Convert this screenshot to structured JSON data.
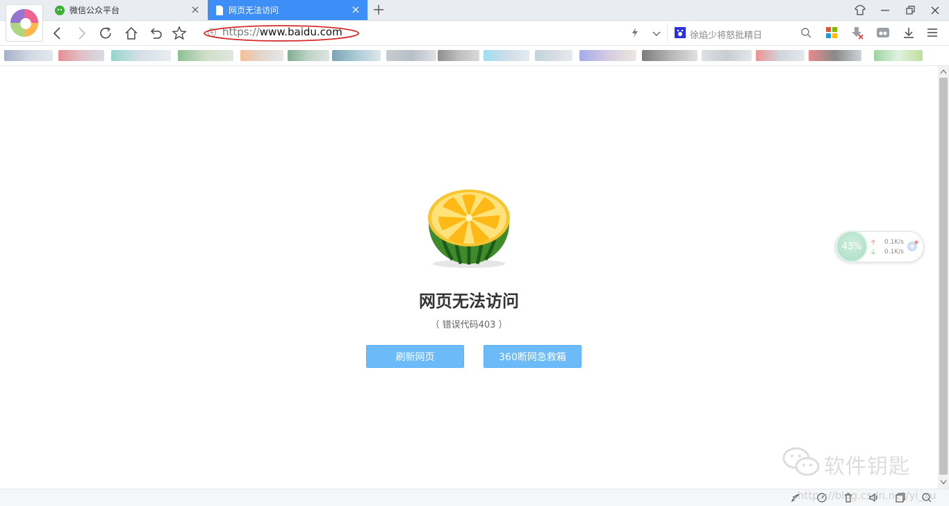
{
  "tabs": [
    {
      "label": "微信公众平台",
      "active": false
    },
    {
      "label": "网页无法访问",
      "active": true
    }
  ],
  "address": {
    "protocol": "https://",
    "host": "www.baidu.com"
  },
  "search": {
    "placeholder": "徐焰少将怒批精日"
  },
  "error": {
    "title": "网页无法访问",
    "code": "（ 错误代码403 ）",
    "refresh_label": "刷新网页",
    "rescue_label": "360断网急救箱"
  },
  "widget": {
    "percent": "43%",
    "up_speed": "0.1K/s",
    "down_speed": "0.1K/s"
  },
  "watermark": {
    "text": "软件钥匙",
    "url": "https://blog.csdn.net/yi_xu"
  },
  "colors": {
    "accent": "#3e8ef7",
    "button": "#6cbbf8"
  }
}
